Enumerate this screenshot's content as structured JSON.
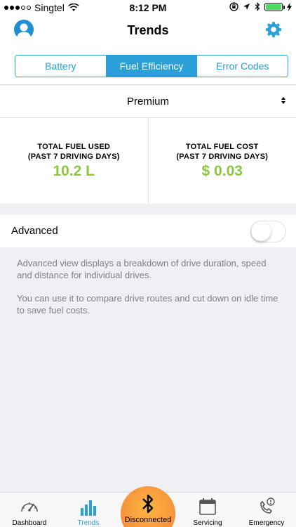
{
  "status_bar": {
    "carrier": "Singtel",
    "time": "8:12 PM"
  },
  "nav": {
    "title": "Trends"
  },
  "tabs_segment": [
    {
      "label": "Battery",
      "active": false
    },
    {
      "label": "Fuel Efficiency",
      "active": true
    },
    {
      "label": "Error Codes",
      "active": false
    }
  ],
  "fuel_type": {
    "selected": "Premium"
  },
  "stats": {
    "fuel_used": {
      "label_line1": "TOTAL FUEL USED",
      "label_line2": "(PAST 7 DRIVING DAYS)",
      "value": "10.2 L"
    },
    "fuel_cost": {
      "label_line1": "TOTAL FUEL COST",
      "label_line2": "(PAST 7 DRIVING DAYS)",
      "value": "$ 0.03"
    }
  },
  "advanced": {
    "label": "Advanced",
    "enabled": false
  },
  "description": {
    "para1": "Advanced view displays a breakdown of drive duration, speed and distance for individual drives.",
    "para2": "You can use it to compare drive routes and cut down on idle time to save fuel costs."
  },
  "tab_bar": {
    "dashboard": "Dashboard",
    "trends": "Trends",
    "connection": "Disconnected",
    "servicing": "Servicing",
    "emergency": "Emergency"
  },
  "colors": {
    "accent": "#2a9fd8",
    "value_green": "#8cc63f",
    "battery_green": "#4cd964",
    "bt_orange": "#f89a3c"
  }
}
